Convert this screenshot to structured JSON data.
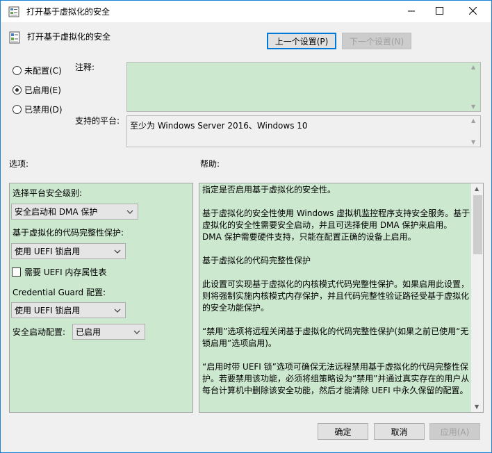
{
  "window": {
    "title": "打开基于虚拟化的安全",
    "controls": {
      "minimize": "minimize",
      "maximize": "maximize",
      "close": "close"
    }
  },
  "header": {
    "setting_name": "打开基于虚拟化的安全",
    "prev_setting": "上一个设置(P)",
    "next_setting": "下一个设置(N)"
  },
  "state": {
    "not_configured": "未配置(C)",
    "enabled": "已启用(E)",
    "disabled": "已禁用(D)",
    "selected": "enabled"
  },
  "comment": {
    "label": "注释:",
    "value": ""
  },
  "platform": {
    "label": "支持的平台:",
    "value": "至少为 Windows Server 2016、Windows 10"
  },
  "sections": {
    "options": "选项:",
    "help": "帮助:"
  },
  "options": {
    "platform_level_label": "选择平台安全级别:",
    "platform_level_value": "安全启动和 DMA 保护",
    "code_integrity_label": "基于虚拟化的代码完整性保护:",
    "code_integrity_value": "使用 UEFI 锁启用",
    "memory_table_label": "需要 UEFI 内存属性表",
    "memory_table_checked": false,
    "credential_guard_label": "Credential Guard 配置:",
    "credential_guard_value": "使用 UEFI 锁启用",
    "secure_launch_label": "安全启动配置:",
    "secure_launch_value": "已启用"
  },
  "help": {
    "paragraphs": [
      "指定是否启用基于虚拟化的安全性。",
      "基于虚拟化的安全性使用 Windows 虚拟机监控程序支持安全服务。基于虚拟化的安全性需要安全启动，并且可选择使用 DMA 保护来启用。DMA 保护需要硬件支持，只能在配置正确的设备上启用。",
      "基于虚拟化的代码完整性保护",
      "此设置可实现基于虚拟化的内核模式代码完整性保护。如果启用此设置，则将强制实施内核模式内存保护，并且代码完整性验证路径受基于虚拟化的安全功能保护。",
      "“禁用”选项将远程关闭基于虚拟化的代码完整性保护(如果之前已使用“无锁启用”选项启用)。",
      "“启用时带 UEFI 锁”选项可确保无法远程禁用基于虚拟化的代码完整性保护。若要禁用该功能，必须将组策略设为“禁用”并通过真实存在的用户从每台计算机中删除该安全功能，然后才能清除 UEFI 中永久保留的配置。"
    ]
  },
  "footer": {
    "ok": "确定",
    "cancel": "取消",
    "apply": "应用(A)"
  }
}
